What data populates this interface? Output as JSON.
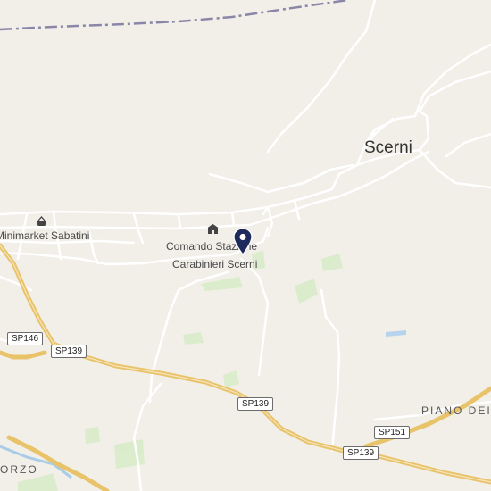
{
  "map": {
    "colors": {
      "background": "#f2efe9",
      "road": "#ffffff",
      "highway": "#e8c36a",
      "green": "#cfe8c0",
      "boundary": "#8a86a8",
      "marker": "#1d2a5b",
      "water": "#b8d4ec"
    },
    "places": {
      "town": "Scerni",
      "area_east": "PIANO DEI",
      "area_southwest": "ORZO"
    },
    "pois": {
      "minimarket": {
        "name": "Minimarket Sabatini",
        "icon": "shopping-basket-icon"
      },
      "carabinieri": {
        "name_line1": "Comando Stazione",
        "name_line2": "Carabinieri Scerni",
        "icon": "police-station-icon"
      }
    },
    "road_shields": {
      "sp146": "SP146",
      "sp139_a": "SP139",
      "sp139_b": "SP139",
      "sp151": "SP151",
      "sp139_c": "SP139"
    },
    "selected_marker": {
      "icon": "location-pin-icon"
    }
  }
}
